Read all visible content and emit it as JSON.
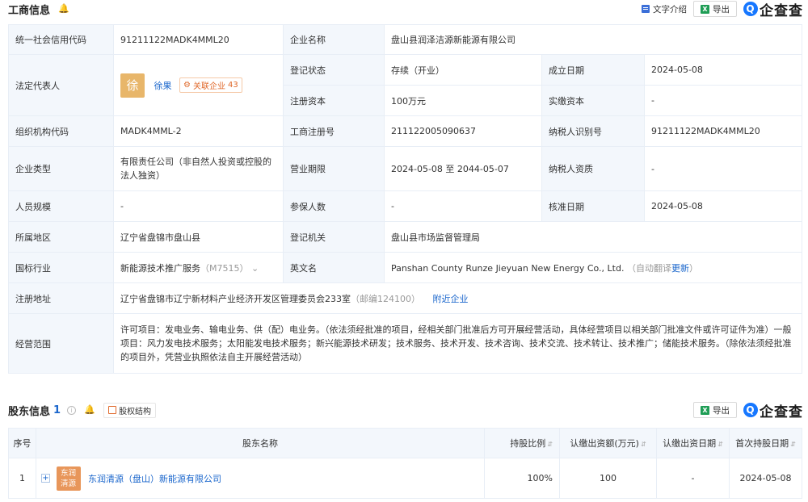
{
  "business_info": {
    "title": "工商信息",
    "text_intro_label": "文字介绍",
    "export_label": "导出",
    "logo_text": "企查查",
    "logo_mark": "Q",
    "rows": {
      "credit_code_label": "统一社会信用代码",
      "credit_code": "91211122MADK4MML20",
      "company_name_label": "企业名称",
      "company_name": "盘山县润泽洁源新能源有限公司",
      "legal_rep_label": "法定代表人",
      "legal_rep_avatar": "徐",
      "legal_rep_name": "徐果",
      "related_label": "关联企业",
      "related_count": "43",
      "reg_status_label": "登记状态",
      "reg_status": "存续（开业）",
      "found_date_label": "成立日期",
      "found_date": "2024-05-08",
      "reg_capital_label": "注册资本",
      "reg_capital": "100万元",
      "paid_capital_label": "实缴资本",
      "paid_capital": "-",
      "org_code_label": "组织机构代码",
      "org_code": "MADK4MML-2",
      "biz_reg_no_label": "工商注册号",
      "biz_reg_no": "211122005090637",
      "taxpayer_id_label": "纳税人识别号",
      "taxpayer_id": "91211122MADK4MML20",
      "company_type_label": "企业类型",
      "company_type": "有限责任公司（非自然人投资或控股的法人独资）",
      "biz_term_label": "营业期限",
      "biz_term": "2024-05-08 至 2044-05-07",
      "taxpayer_qual_label": "纳税人资质",
      "taxpayer_qual": "-",
      "staff_size_label": "人员规模",
      "staff_size": "-",
      "insured_label": "参保人数",
      "insured": "-",
      "approve_date_label": "核准日期",
      "approve_date": "2024-05-08",
      "region_label": "所属地区",
      "region": "辽宁省盘锦市盘山县",
      "reg_authority_label": "登记机关",
      "reg_authority": "盘山县市场监督管理局",
      "industry_label": "国标行业",
      "industry": "新能源技术推广服务",
      "industry_code": "（M7515）",
      "english_name_label": "英文名",
      "english_name": "Panshan County Runze Jieyuan New Energy Co., Ltd.",
      "auto_translate": "（自动翻译",
      "update_link": "更新",
      "auto_translate_end": "）",
      "address_label": "注册地址",
      "address": "辽宁省盘锦市辽宁新材料产业经济开发区管理委员会233室",
      "postcode": "（邮编124100）",
      "nearby_link": "附近企业",
      "scope_label": "经营范围",
      "scope": "许可项目：发电业务、输电业务、供（配）电业务。（依法须经批准的项目，经相关部门批准后方可开展经营活动，具体经营项目以相关部门批准文件或许可证件为准）一般项目：风力发电技术服务；太阳能发电技术服务；新兴能源技术研发；技术服务、技术开发、技术咨询、技术交流、技术转让、技术推广；储能技术服务。（除依法须经批准的项目外，凭营业执照依法自主开展经营活动）"
    }
  },
  "shareholders": {
    "title": "股东信息",
    "count": "1",
    "equity_label": "股权结构",
    "export_label": "导出",
    "logo_text": "企查查",
    "logo_mark": "Q",
    "columns": {
      "index": "序号",
      "name": "股东名称",
      "ratio": "持股比例",
      "subscribed": "认缴出资额(万元)",
      "sub_date": "认缴出资日期",
      "first_date": "首次持股日期"
    },
    "rows": [
      {
        "index": "1",
        "logo_line1": "东润",
        "logo_line2": "清源",
        "name": "东润清源（盘山）新能源有限公司",
        "ratio": "100%",
        "subscribed": "100",
        "sub_date": "-",
        "first_date": "2024-05-08"
      }
    ]
  }
}
